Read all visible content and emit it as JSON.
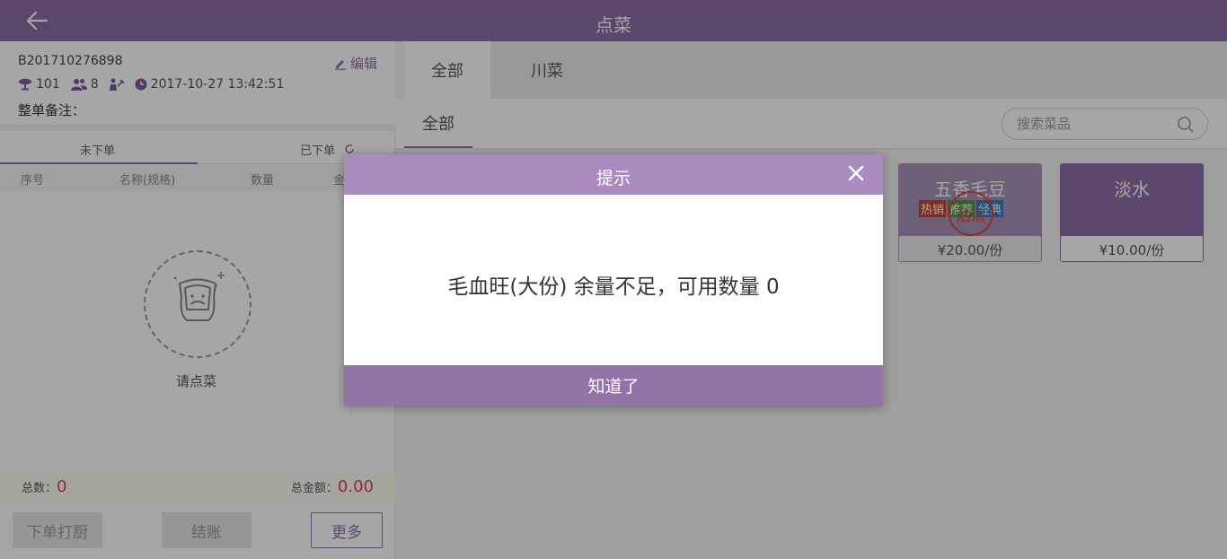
{
  "header": {
    "title": "点菜",
    "back_icon": "arrow-left-icon"
  },
  "order": {
    "number": "B201710276898",
    "edit_label": "编辑",
    "table": "101",
    "guests": "8",
    "datetime": "2017-10-27 13:42:51",
    "note_label": "整单备注："
  },
  "order_tabs": {
    "pending": "未下单",
    "placed": "已下单"
  },
  "table_headers": {
    "seq": "序号",
    "name": "名称(规格)",
    "qty": "数量",
    "amount": "金"
  },
  "empty": {
    "label": "请点菜"
  },
  "totals": {
    "count_label": "总数：",
    "count": "0",
    "amount_label": "总金额：",
    "amount": "0.00"
  },
  "buttons": {
    "print": "下单打厨",
    "pay": "结账",
    "more": "更多"
  },
  "categories": [
    "全部",
    "川菜"
  ],
  "subcategory": "全部",
  "search": {
    "placeholder": "搜索菜品"
  },
  "dishes": [
    {
      "name": "五香毛豆",
      "price": "¥20.00/份",
      "tags": [
        "热销",
        "推荐",
        "经典"
      ],
      "status": "沽清"
    },
    {
      "name": "淡水",
      "price": "¥10.00/份"
    }
  ],
  "modal": {
    "title": "提示",
    "message": "毛血旺(大份) 余量不足，可用数量 0",
    "ok_label": "知道了"
  },
  "colors": {
    "primary": "#8c6ea6",
    "modal_header": "#a88cc0",
    "accent_red": "#e0414b"
  }
}
